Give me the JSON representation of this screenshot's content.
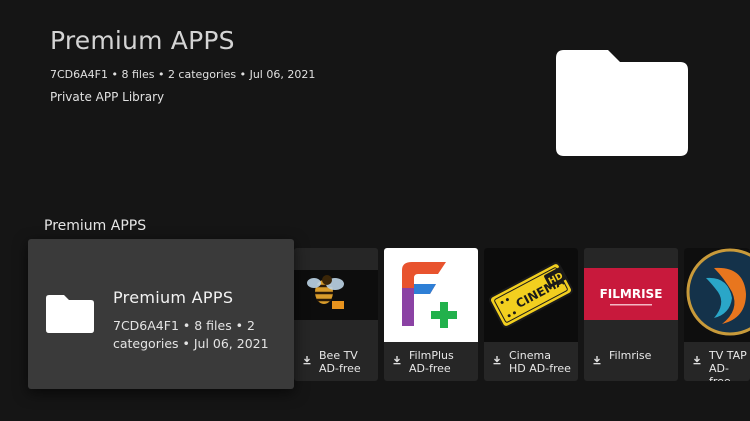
{
  "header": {
    "title": "Premium APPS",
    "meta": "7CD6A4F1 • 8 files • 2 categories • Jul 06, 2021",
    "subtitle": "Private APP Library"
  },
  "section": {
    "title": "Premium APPS"
  },
  "focused": {
    "title": "Premium APPS",
    "meta": "7CD6A4F1 • 8 files • 2 categories • Jul 06, 2021",
    "icon": "folder-icon"
  },
  "apps": [
    {
      "label": "Bee TV AD-free",
      "icon": "bee-tv-logo"
    },
    {
      "label": "FilmPlus AD-free",
      "icon": "filmplus-logo"
    },
    {
      "label": "Cinema HD AD-free",
      "icon": "cinema-hd-logo",
      "logo_text": "CINEMA HD"
    },
    {
      "label": "Filmrise",
      "icon": "filmrise-logo",
      "logo_text": "FILMRISE"
    },
    {
      "label": "TV TAP AD-free",
      "icon": "tv-tap-logo"
    }
  ],
  "colors": {
    "background": "#151515",
    "card": "#262626",
    "focused_card": "#3a3a3a",
    "filmplus_orange": "#e8532e",
    "filmplus_blue": "#2e7fd6",
    "filmplus_green": "#22b14c",
    "cinema_yellow": "#f2cf1f",
    "filmrise_red": "#c8193c"
  }
}
